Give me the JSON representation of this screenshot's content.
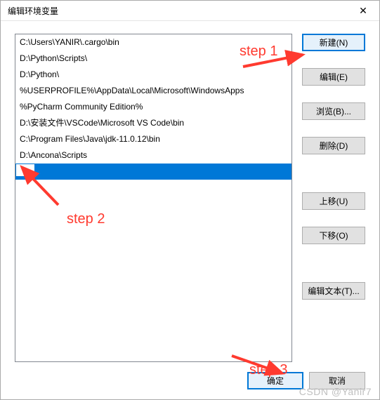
{
  "titlebar": {
    "title": "编辑环境变量",
    "close": "✕"
  },
  "list": {
    "items": [
      "C:\\Users\\YANIR\\.cargo\\bin",
      "D:\\Python\\Scripts\\",
      "D:\\Python\\",
      "%USERPROFILE%\\AppData\\Local\\Microsoft\\WindowsApps",
      "%PyCharm Community Edition%",
      "D:\\安装文件\\VSCode\\Microsoft VS Code\\bin",
      "C:\\Program Files\\Java\\jdk-11.0.12\\bin",
      "D:\\Ancona\\Scripts"
    ],
    "editing_value": ""
  },
  "buttons": {
    "new_": "新建(N)",
    "edit": "编辑(E)",
    "browse": "浏览(B)...",
    "delete_": "删除(D)",
    "move_up": "上移(U)",
    "move_down": "下移(O)",
    "edit_text": "编辑文本(T)...",
    "ok": "确定",
    "cancel": "取消"
  },
  "annotations": {
    "step1": "step 1",
    "step2": "step 2",
    "step3": "step 3",
    "colors": {
      "arrow": "#ff3a2f"
    }
  },
  "watermark": "CSDN @Yanir7"
}
